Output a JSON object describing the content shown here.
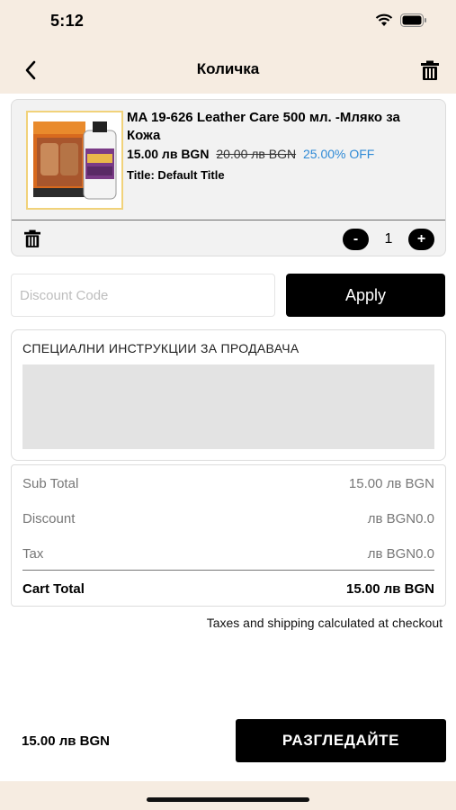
{
  "status_bar": {
    "time": "5:12"
  },
  "header": {
    "title": "Количка",
    "back_icon": "chevron-left-icon",
    "delete_icon": "trash-icon"
  },
  "cart_item": {
    "name": "MA 19-626 Leather Care 500 мл. -Мляко за Кожа",
    "price": "15.00 лв BGN",
    "compare_price": "20.00 лв BGN",
    "discount_label": "25.00% OFF",
    "variant": "Title: Default Title",
    "quantity": "1",
    "decrement_label": "-",
    "increment_label": "+"
  },
  "discount": {
    "placeholder": "Discount Code",
    "apply_label": "Apply"
  },
  "instructions": {
    "label": "СПЕЦИАЛНИ ИНСТРУКЦИИ ЗА ПРОДАВАЧА"
  },
  "summary": {
    "subtotal_label": "Sub Total",
    "subtotal_value": "15.00 лв BGN",
    "discount_label": "Discount",
    "discount_value": "лв BGN0.0",
    "tax_label": "Tax",
    "tax_value": "лв BGN0.0",
    "total_label": "Cart Total",
    "total_value": "15.00 лв BGN"
  },
  "tax_note": "Taxes and shipping calculated at checkout",
  "footer": {
    "total": "15.00 лв BGN",
    "checkout_label": "РАЗГЛЕДАЙТЕ"
  },
  "colors": {
    "header_bg": "#f6ece1",
    "discount_blue": "#2f8ad6",
    "button_bg": "#000000"
  }
}
